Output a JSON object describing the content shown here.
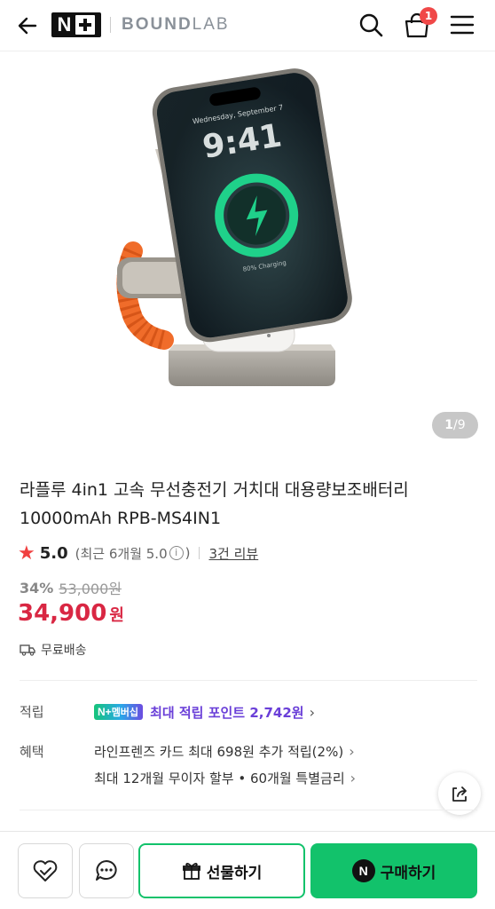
{
  "header": {
    "brand_logo_text": "N+",
    "brand_name_bold": "BOUND",
    "brand_name_light": "LAB",
    "cart_count": "1"
  },
  "gallery": {
    "current": "1",
    "separator": "/",
    "total": "9",
    "phone_time": "9:41",
    "phone_date": "Wednesday, September 7",
    "phone_charging": "80% Charging"
  },
  "product": {
    "title": "라플루 4in1 고속 무선충전기 거치대 대용량보조배터리 10000mAh RPB-MS4IN1",
    "rating": "5.0",
    "recent_prefix": "(최근 6개월 5.0",
    "recent_suffix": ")",
    "review_link": "3건 리뷰",
    "discount_rate": "34%",
    "original_price": "53,000원",
    "price": "34,900",
    "currency": "원",
    "shipping": "무료배송"
  },
  "points": {
    "label": "적립",
    "badge_plus": "N+",
    "badge_text": "멤버십",
    "text": "최대 적립 포인트 2,742원"
  },
  "benefits": {
    "label": "혜택",
    "line1": "라인프렌즈 카드 최대 698원 추가 적립(2%)",
    "line2": "최대 12개월 무이자 할부 • 60개월 특별금리"
  },
  "actions": {
    "gift": "선물하기",
    "buy": "구매하기",
    "buy_badge": "N"
  },
  "colors": {
    "accent_green": "#12c26b",
    "price_red": "#d92743",
    "membership_purple": "#6a3fd8"
  }
}
